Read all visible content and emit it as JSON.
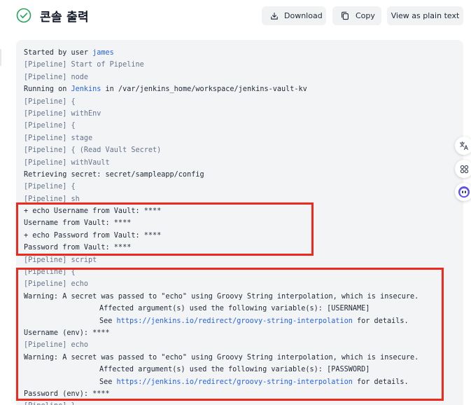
{
  "header": {
    "title": "콘솔 출력",
    "status_icon": "check-circle-icon",
    "status_color": "#22a559",
    "buttons": {
      "download": {
        "label": "Download",
        "icon": "download-icon"
      },
      "copy": {
        "label": "Copy",
        "icon": "copy-icon"
      },
      "plain": {
        "label": "View as plain text"
      }
    }
  },
  "console": {
    "lines": [
      [
        {
          "t": "Started by user "
        },
        {
          "t": "james",
          "c": "lnk"
        }
      ],
      [
        {
          "t": "[Pipeline] Start of Pipeline",
          "c": "dim"
        }
      ],
      [
        {
          "t": "[Pipeline] node",
          "c": "dim"
        }
      ],
      [
        {
          "t": "Running on "
        },
        {
          "t": "Jenkins",
          "c": "lnk"
        },
        {
          "t": " in /var/jenkins_home/workspace/jenkins-vault-kv"
        }
      ],
      [
        {
          "t": "[Pipeline] {",
          "c": "dim"
        }
      ],
      [
        {
          "t": "[Pipeline] withEnv",
          "c": "dim"
        }
      ],
      [
        {
          "t": "[Pipeline] {",
          "c": "dim"
        }
      ],
      [
        {
          "t": "[Pipeline] stage",
          "c": "dim"
        }
      ],
      [
        {
          "t": "[Pipeline] { (Read Vault Secret)",
          "c": "dim"
        }
      ],
      [
        {
          "t": "[Pipeline] withVault",
          "c": "dim"
        }
      ],
      [
        {
          "t": "Retrieving secret: secret/sampleapp/config"
        }
      ],
      [
        {
          "t": "[Pipeline] {",
          "c": "dim"
        }
      ],
      [
        {
          "t": "[Pipeline] sh",
          "c": "dim"
        }
      ],
      [
        {
          "t": "+ echo Username from Vault: ****"
        }
      ],
      [
        {
          "t": "Username from Vault: ****"
        }
      ],
      [
        {
          "t": "+ echo Password from Vault: ****"
        }
      ],
      [
        {
          "t": "Password from Vault: ****"
        }
      ],
      [
        {
          "t": "[Pipeline] script",
          "c": "dim"
        }
      ],
      [
        {
          "t": "[Pipeline] {",
          "c": "dim"
        }
      ],
      [
        {
          "t": "[Pipeline] echo",
          "c": "dim"
        }
      ],
      [
        {
          "t": "Warning: A secret was passed to \"echo\" using Groovy String interpolation, which is insecure."
        }
      ],
      [
        {
          "t": "Affected argument(s) used the following variable(s): [USERNAME]",
          "i": true
        }
      ],
      [
        {
          "t": "See ",
          "i": true
        },
        {
          "t": "https://jenkins.io/redirect/groovy-string-interpolation",
          "c": "lnk"
        },
        {
          "t": " for details."
        }
      ],
      [
        {
          "t": "Username (env): ****"
        }
      ],
      [
        {
          "t": "[Pipeline] echo",
          "c": "dim"
        }
      ],
      [
        {
          "t": "Warning: A secret was passed to \"echo\" using Groovy String interpolation, which is insecure."
        }
      ],
      [
        {
          "t": "Affected argument(s) used the following variable(s): [PASSWORD]",
          "i": true
        }
      ],
      [
        {
          "t": "See ",
          "i": true
        },
        {
          "t": "https://jenkins.io/redirect/groovy-string-interpolation",
          "c": "lnk"
        },
        {
          "t": " for details."
        }
      ],
      [
        {
          "t": "Password (env): ****"
        }
      ],
      [
        {
          "t": "[Pipeline] }",
          "c": "dim"
        }
      ]
    ]
  },
  "highlights": [
    {
      "color": "#ee2a1e",
      "label": "vault-output-highlight"
    },
    {
      "color": "#ee2a1e",
      "label": "env-echo-highlight"
    }
  ],
  "side_dock": {
    "icons": [
      "translate-icon",
      "apps-icon",
      "assistant-bot-icon"
    ]
  },
  "colors": {
    "link": "#2563eb",
    "pipeline_dim": "#64748b",
    "console_bg": "#f3f4f6",
    "button_bg": "#f1f2f4"
  }
}
